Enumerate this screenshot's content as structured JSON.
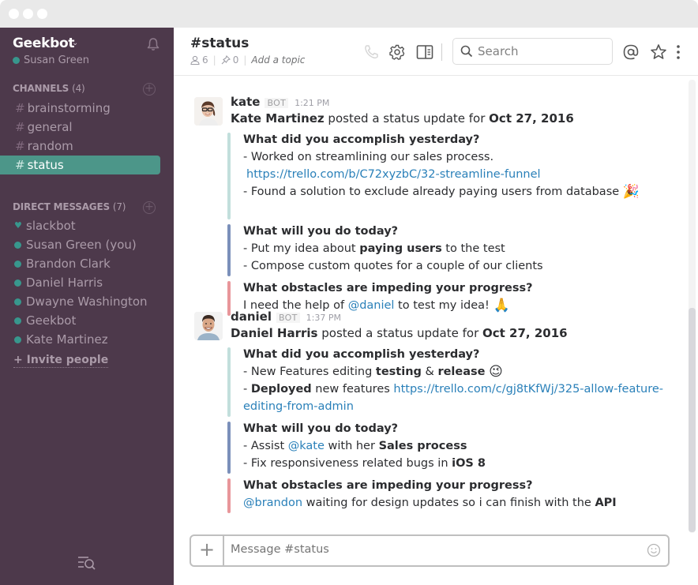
{
  "window": {
    "controls": [
      "close",
      "minimize",
      "maximize"
    ]
  },
  "sidebar": {
    "team_name": "Geekbot",
    "current_user": "Susan Green",
    "channels_header": "CHANNELS",
    "channels_count": "(4)",
    "channels": [
      {
        "name": "brainstorming",
        "active": false
      },
      {
        "name": "general",
        "active": false
      },
      {
        "name": "random",
        "active": false
      },
      {
        "name": "status",
        "active": true
      }
    ],
    "dm_header": "DIRECT MESSAGES",
    "dm_count": "(7)",
    "direct_messages": [
      {
        "name": "slackbot",
        "icon": "heart"
      },
      {
        "name": "Susan Green (you)",
        "icon": "presence-dot"
      },
      {
        "name": "Brandon Clark",
        "icon": "presence-dot"
      },
      {
        "name": "Daniel Harris",
        "icon": "presence-dot"
      },
      {
        "name": "Dwayne Washington",
        "icon": "presence-dot"
      },
      {
        "name": "Geekbot",
        "icon": "presence-dot"
      },
      {
        "name": "Kate Martinez",
        "icon": "presence-dot"
      }
    ],
    "invite_label": "+ Invite people",
    "hash": "#",
    "accent_color": "#4c9689",
    "bg_color": "#4d394b"
  },
  "header": {
    "channel_title": "#status",
    "member_count": "6",
    "pin_count": "0",
    "topic_placeholder": "Add a topic",
    "search_placeholder": "Search",
    "separator": "|"
  },
  "messages": [
    {
      "username": "kate",
      "badge": "BOT",
      "time": "1:21 PM",
      "poster": "Kate Martinez",
      "posted_text": " posted a status update for ",
      "date": "Oct 27, 2016",
      "sections": [
        {
          "color": "#c2dfdc",
          "title": "What did you accomplish yesterday?",
          "lines": [
            "- Worked on streamlining our sales process.",
            "https://trello.com/b/C72xyzbC/32-streamline-funnel",
            "- Found a solution to exclude already paying users from database"
          ]
        },
        {
          "color": "#7b90ba",
          "title": "What will you do today?",
          "lines": [
            "- Put my idea about ",
            "paying users",
            " to the test",
            "- Compose custom quotes for a couple of our clients"
          ]
        },
        {
          "color": "#e8969a",
          "title": "What obstacles are impeding your progress?",
          "lines": [
            "I need the help of ",
            "@daniel",
            " to test my idea!"
          ]
        }
      ]
    },
    {
      "username": "daniel",
      "badge": "BOT",
      "time": "1:37 PM",
      "poster": "Daniel Harris",
      "posted_text": " posted a status update for ",
      "date": "Oct 27, 2016",
      "sections": [
        {
          "color": "#c2dfdc",
          "title": "What did you accomplish yesterday?",
          "lines": [
            "- New Features editing ",
            "testing",
            " & ",
            "release",
            "- ",
            "Deployed",
            " new features ",
            "https://trello.com/c/gj8tKfWj/325-allow-feature-",
            "editing-from-admin"
          ]
        },
        {
          "color": "#7b90ba",
          "title": "What will you do today?",
          "lines": [
            "- Assist ",
            "@kate",
            " with her ",
            "Sales process",
            "- Fix responsiveness related bugs in ",
            "iOS 8"
          ]
        },
        {
          "color": "#e8969a",
          "title": "What obstacles are impeding your progress?",
          "lines": [
            "@brandon",
            " waiting for design updates so i can finish with the ",
            "API"
          ]
        }
      ]
    }
  ],
  "composer": {
    "placeholder": "Message #status",
    "plus_label": "+"
  },
  "colors": {
    "link": "#2a80b9",
    "text": "#2c2d30"
  }
}
